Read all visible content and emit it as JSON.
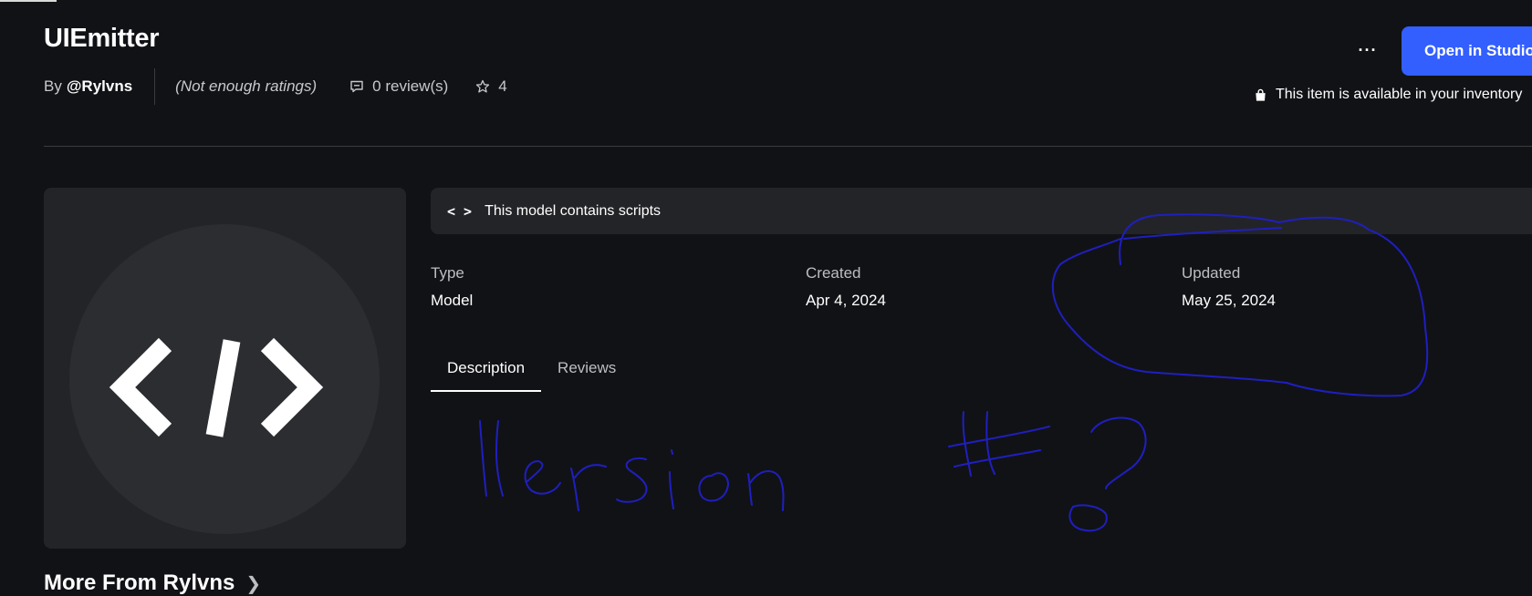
{
  "item": {
    "title": "UIEmitter",
    "by_prefix": "By",
    "creator": "@Rylvns",
    "ratings": "(Not enough ratings)",
    "reviews": "0 review(s)",
    "favorites": "4",
    "more_menu": "···",
    "open_button": "Open in Studio",
    "inventory_note": "This item is available in your inventory"
  },
  "scripts_notice": {
    "icon": "</>",
    "text": "This model contains scripts"
  },
  "details": {
    "type_label": "Type",
    "type_value": "Model",
    "created_label": "Created",
    "created_value": "Apr 4, 2024",
    "updated_label": "Updated",
    "updated_value": "May 25, 2024"
  },
  "tabs": [
    {
      "label": "Description",
      "active": true
    },
    {
      "label": "Reviews",
      "active": false
    }
  ],
  "more_from": {
    "label": "More From Rylvns"
  },
  "annotation": {
    "text": "Version #?",
    "color": "#1f1fbf"
  },
  "icons": {
    "thumbnail": "code-icon",
    "reviews": "comment-icon",
    "favorites": "star-icon",
    "inventory": "shopping-bag-icon",
    "more": "ellipsis-icon",
    "chevron": "chevron-right-icon"
  },
  "colors": {
    "background": "#111216",
    "accent": "#335fff",
    "panel": "#232428"
  }
}
